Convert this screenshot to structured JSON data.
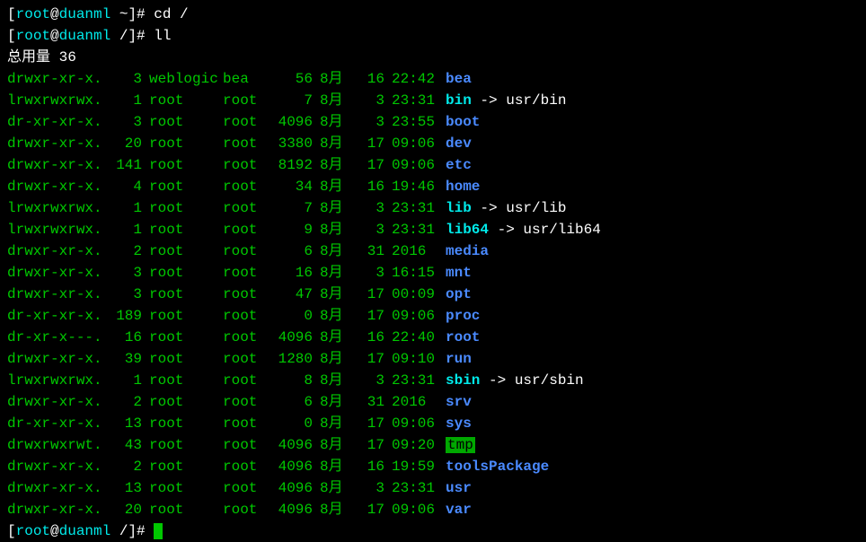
{
  "prompt1": {
    "open": "[",
    "user": "root",
    "at": "@",
    "host": "duanml",
    "dir": " ~",
    "close": "]# ",
    "cmd": "cd /"
  },
  "prompt2": {
    "open": "[",
    "user": "root",
    "at": "@",
    "host": "duanml",
    "dir": " /",
    "close": "]# ",
    "cmd": "ll"
  },
  "total": "总用量 36",
  "files": [
    {
      "perm": "drwxr-xr-x.",
      "links": "3",
      "user": "weblogic",
      "group": "bea",
      "size": "56",
      "month": "8月",
      "day": "16",
      "time": "22:42",
      "name": "bea",
      "type": "dir"
    },
    {
      "perm": "lrwxrwxrwx.",
      "links": "1",
      "user": "root",
      "group": "root",
      "size": "7",
      "month": "8月",
      "day": "3",
      "time": "23:31",
      "name": "bin",
      "type": "link",
      "target": "usr/bin"
    },
    {
      "perm": "dr-xr-xr-x.",
      "links": "3",
      "user": "root",
      "group": "root",
      "size": "4096",
      "month": "8月",
      "day": "3",
      "time": "23:55",
      "name": "boot",
      "type": "dir"
    },
    {
      "perm": "drwxr-xr-x.",
      "links": "20",
      "user": "root",
      "group": "root",
      "size": "3380",
      "month": "8月",
      "day": "17",
      "time": "09:06",
      "name": "dev",
      "type": "dir"
    },
    {
      "perm": "drwxr-xr-x.",
      "links": "141",
      "user": "root",
      "group": "root",
      "size": "8192",
      "month": "8月",
      "day": "17",
      "time": "09:06",
      "name": "etc",
      "type": "dir"
    },
    {
      "perm": "drwxr-xr-x.",
      "links": "4",
      "user": "root",
      "group": "root",
      "size": "34",
      "month": "8月",
      "day": "16",
      "time": "19:46",
      "name": "home",
      "type": "dir"
    },
    {
      "perm": "lrwxrwxrwx.",
      "links": "1",
      "user": "root",
      "group": "root",
      "size": "7",
      "month": "8月",
      "day": "3",
      "time": "23:31",
      "name": "lib",
      "type": "link",
      "target": "usr/lib"
    },
    {
      "perm": "lrwxrwxrwx.",
      "links": "1",
      "user": "root",
      "group": "root",
      "size": "9",
      "month": "8月",
      "day": "3",
      "time": "23:31",
      "name": "lib64",
      "type": "link",
      "target": "usr/lib64"
    },
    {
      "perm": "drwxr-xr-x.",
      "links": "2",
      "user": "root",
      "group": "root",
      "size": "6",
      "month": "8月",
      "day": "31",
      "time": "2016",
      "name": "media",
      "type": "dir"
    },
    {
      "perm": "drwxr-xr-x.",
      "links": "3",
      "user": "root",
      "group": "root",
      "size": "16",
      "month": "8月",
      "day": "3",
      "time": "16:15",
      "name": "mnt",
      "type": "dir"
    },
    {
      "perm": "drwxr-xr-x.",
      "links": "3",
      "user": "root",
      "group": "root",
      "size": "47",
      "month": "8月",
      "day": "17",
      "time": "00:09",
      "name": "opt",
      "type": "dir"
    },
    {
      "perm": "dr-xr-xr-x.",
      "links": "189",
      "user": "root",
      "group": "root",
      "size": "0",
      "month": "8月",
      "day": "17",
      "time": "09:06",
      "name": "proc",
      "type": "dir"
    },
    {
      "perm": "dr-xr-x---.",
      "links": "16",
      "user": "root",
      "group": "root",
      "size": "4096",
      "month": "8月",
      "day": "16",
      "time": "22:40",
      "name": "root",
      "type": "dir"
    },
    {
      "perm": "drwxr-xr-x.",
      "links": "39",
      "user": "root",
      "group": "root",
      "size": "1280",
      "month": "8月",
      "day": "17",
      "time": "09:10",
      "name": "run",
      "type": "dir"
    },
    {
      "perm": "lrwxrwxrwx.",
      "links": "1",
      "user": "root",
      "group": "root",
      "size": "8",
      "month": "8月",
      "day": "3",
      "time": "23:31",
      "name": "sbin",
      "type": "link",
      "target": "usr/sbin"
    },
    {
      "perm": "drwxr-xr-x.",
      "links": "2",
      "user": "root",
      "group": "root",
      "size": "6",
      "month": "8月",
      "day": "31",
      "time": "2016",
      "name": "srv",
      "type": "dir"
    },
    {
      "perm": "dr-xr-xr-x.",
      "links": "13",
      "user": "root",
      "group": "root",
      "size": "0",
      "month": "8月",
      "day": "17",
      "time": "09:06",
      "name": "sys",
      "type": "dir"
    },
    {
      "perm": "drwxrwxrwt.",
      "links": "43",
      "user": "root",
      "group": "root",
      "size": "4096",
      "month": "8月",
      "day": "17",
      "time": "09:20",
      "name": "tmp",
      "type": "sticky"
    },
    {
      "perm": "drwxr-xr-x.",
      "links": "2",
      "user": "root",
      "group": "root",
      "size": "4096",
      "month": "8月",
      "day": "16",
      "time": "19:59",
      "name": "toolsPackage",
      "type": "dir"
    },
    {
      "perm": "drwxr-xr-x.",
      "links": "13",
      "user": "root",
      "group": "root",
      "size": "4096",
      "month": "8月",
      "day": "3",
      "time": "23:31",
      "name": "usr",
      "type": "dir"
    },
    {
      "perm": "drwxr-xr-x.",
      "links": "20",
      "user": "root",
      "group": "root",
      "size": "4096",
      "month": "8月",
      "day": "17",
      "time": "09:06",
      "name": "var",
      "type": "dir"
    }
  ],
  "prompt3": {
    "open": "[",
    "user": "root",
    "at": "@",
    "host": "duanml",
    "dir": " /",
    "close": "]# "
  }
}
